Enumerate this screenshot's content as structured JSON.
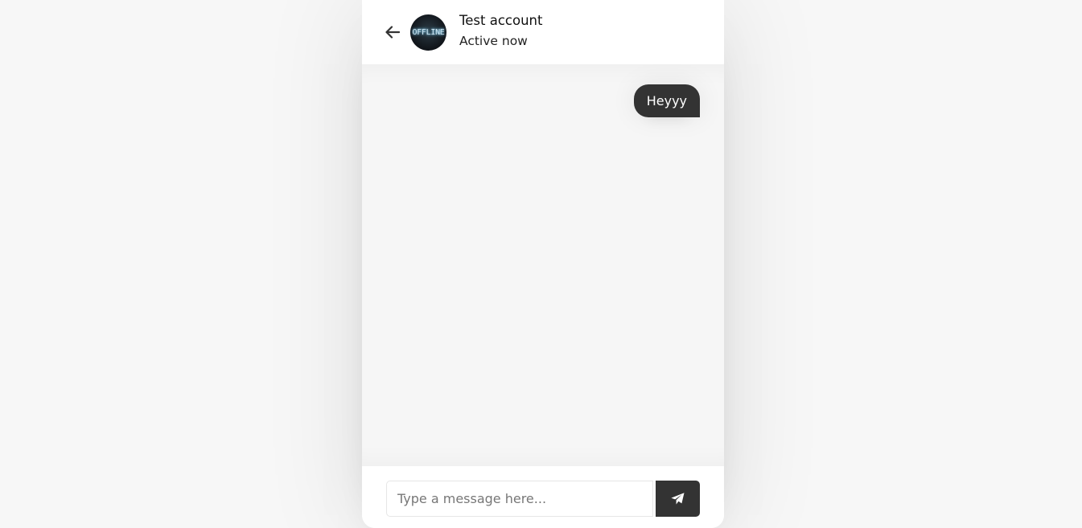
{
  "header": {
    "name": "Test account",
    "status": "Active now",
    "avatar_text": "OFFLINE"
  },
  "icons": {
    "back": "arrow-left-icon",
    "send": "paper-plane-icon"
  },
  "messages": [
    {
      "type": "outgoing",
      "text": "Heyyy"
    }
  ],
  "typing": {
    "placeholder": "Type a message here...",
    "value": ""
  },
  "colors": {
    "accent": "#333333",
    "background": "#f7f7f7",
    "chat_background": "#f6f6f6"
  }
}
